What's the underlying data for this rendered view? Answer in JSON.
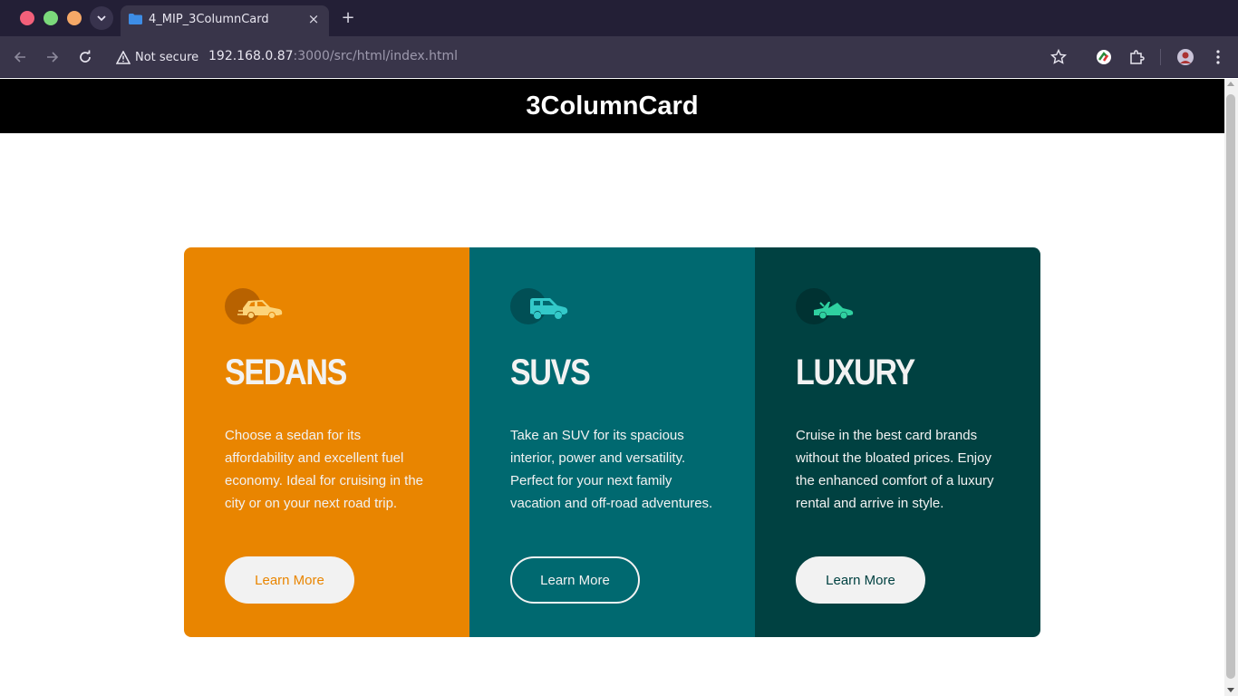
{
  "browser": {
    "tab_title": "4_MIP_3ColumnCard",
    "tab_close": "×",
    "new_tab": "+",
    "security_label": "Not secure",
    "url_host": "192.168.0.87",
    "url_rest": ":3000/src/html/index.html"
  },
  "page": {
    "title": "3ColumnCard"
  },
  "cards": [
    {
      "icon": "sedan-car-icon",
      "title": "SEDANS",
      "text": "Choose a sedan for its affordability and excellent fuel economy. Ideal for cruising in the city or on your next road trip.",
      "button": "Learn More",
      "color": "#e98500",
      "icon_color": "#fcd47a"
    },
    {
      "icon": "suv-car-icon",
      "title": "SUVS",
      "text": "Take an SUV for its spacious interior, power and versatility. Perfect for your next family vacation and off-road adventures.",
      "button": "Learn More",
      "color": "#006970",
      "icon_color": "#33c9c9"
    },
    {
      "icon": "luxury-car-icon",
      "title": "LUXURY",
      "text": "Cruise in the best card brands without the bloated prices. Enjoy the enhanced comfort of a luxury rental and arrive in style.",
      "button": "Learn More",
      "color": "#004141",
      "icon_color": "#2fd0a0"
    }
  ]
}
